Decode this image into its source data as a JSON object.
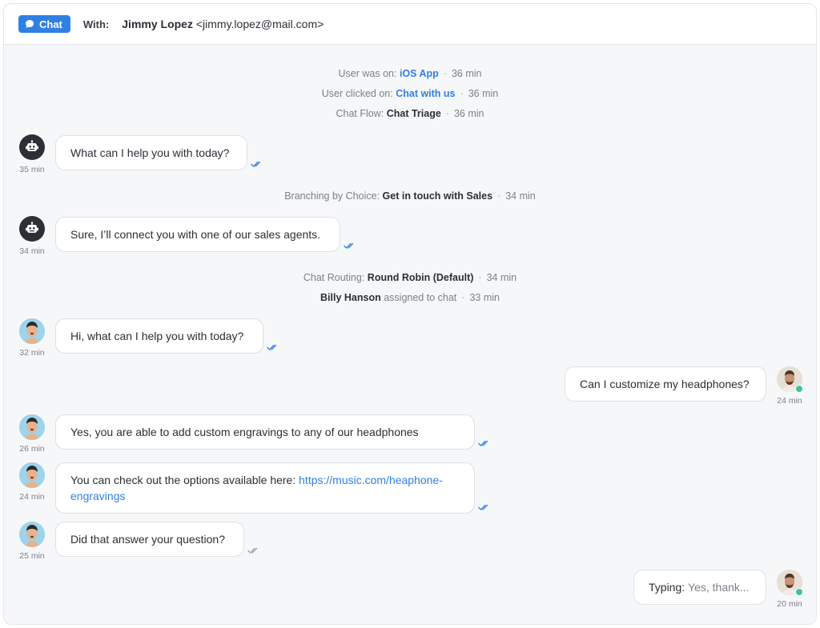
{
  "header": {
    "badge_label": "Chat",
    "with_label": "With:",
    "contact_name": "Jimmy Lopez",
    "contact_email": "<jimmy.lopez@mail.com>"
  },
  "system_events": {
    "e1": {
      "prefix": "User was on:",
      "value": "iOS App",
      "time": "36 min"
    },
    "e2": {
      "prefix": "User clicked on:",
      "value": "Chat with us",
      "time": "36 min"
    },
    "e3": {
      "prefix": "Chat Flow:",
      "value": "Chat Triage",
      "time": "36 min"
    },
    "e4": {
      "prefix": "Branching by Choice:",
      "value": "Get in touch with Sales",
      "time": "34 min"
    },
    "e5": {
      "prefix": "Chat Routing:",
      "value": "Round Robin (Default)",
      "time": "34 min"
    },
    "e6": {
      "name": "Billy Hanson",
      "suffix": "assigned to chat",
      "time": "33 min"
    }
  },
  "messages": {
    "m1": {
      "text": "What can I help you with today?",
      "time": "35 min"
    },
    "m2": {
      "text": "Sure, I’ll connect you with one of our sales agents.",
      "time": "34 min"
    },
    "m3": {
      "text": "Hi, what can I help you with today?",
      "time": "32 min"
    },
    "m4": {
      "text": "Can I customize my headphones?",
      "time": "24 min"
    },
    "m5": {
      "text": "Yes, you are able to add custom engravings to any of our headphones",
      "time": "26 min"
    },
    "m6": {
      "text": "You can check out the options available here:",
      "link": "https://music.com/heaphone-engravings",
      "time": "24 min"
    },
    "m7": {
      "text": "Did that answer your question?",
      "time": "25 min"
    },
    "m8": {
      "prefix": "Typing:",
      "text": "Yes, thank...",
      "time": "20 min"
    }
  },
  "colors": {
    "accent": "#2f80e4",
    "online": "#3cc49a",
    "bot_avatar": "#2b2f36",
    "agent_avatar": "#9fd3ec"
  },
  "icons": {
    "badge": "chat-bubble-icon",
    "bot": "robot-icon",
    "read_receipt": "double-check-icon"
  }
}
